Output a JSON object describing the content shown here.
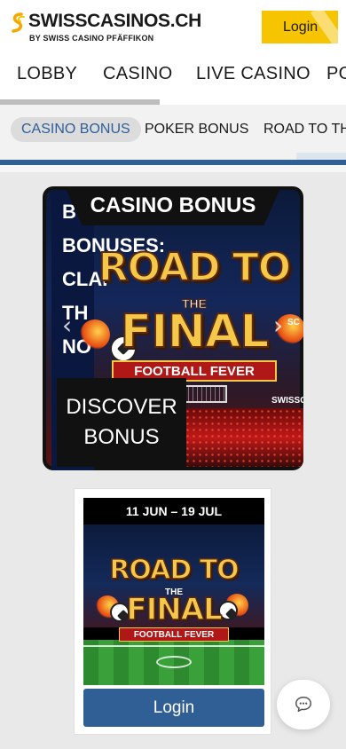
{
  "header": {
    "logo_title": "SWISSCASINOS.CH",
    "logo_subtitle": "BY SWISS CASINO PFÄFFIKON",
    "login_label": "Login",
    "brand_color": "#f6c400"
  },
  "main_nav": {
    "items": [
      {
        "label": "LOBBY"
      },
      {
        "label": "CASINO"
      },
      {
        "label": "LIVE CASINO"
      },
      {
        "label": "PO"
      }
    ],
    "active": "CASINO"
  },
  "sub_nav": {
    "items": [
      {
        "label": "CASINO BONUS"
      },
      {
        "label": "POKER BONUS"
      },
      {
        "label": "ROAD TO THE"
      }
    ],
    "active": "CASINO BONUS",
    "accent_color": "#2f5f95"
  },
  "hero": {
    "tag": "CASINO BONUS",
    "text_lines": [
      "B",
      "BONUSES:",
      "CLAI",
      "TH",
      "NO"
    ],
    "art_title_1": "ROAD TO",
    "art_the": "THE",
    "art_title_2": "FINAL",
    "art_ribbon": "FOOTBALL FEVER",
    "discover_line1": "DISCOVER",
    "discover_line2": "BONUS",
    "brand_mark": "SWISSCASI",
    "brand_mark_2": "SC",
    "arrow_left": "‹",
    "arrow_right": "›"
  },
  "promo_card": {
    "date_range": "11 JUN – 19 JUL",
    "title_1": "ROAD TO",
    "the": "THE",
    "title_2": "FINAL",
    "ribbon": "FOOTBALL FEVER",
    "login_label": "Login"
  },
  "chat": {
    "icon": "chat-bubble-icon"
  }
}
